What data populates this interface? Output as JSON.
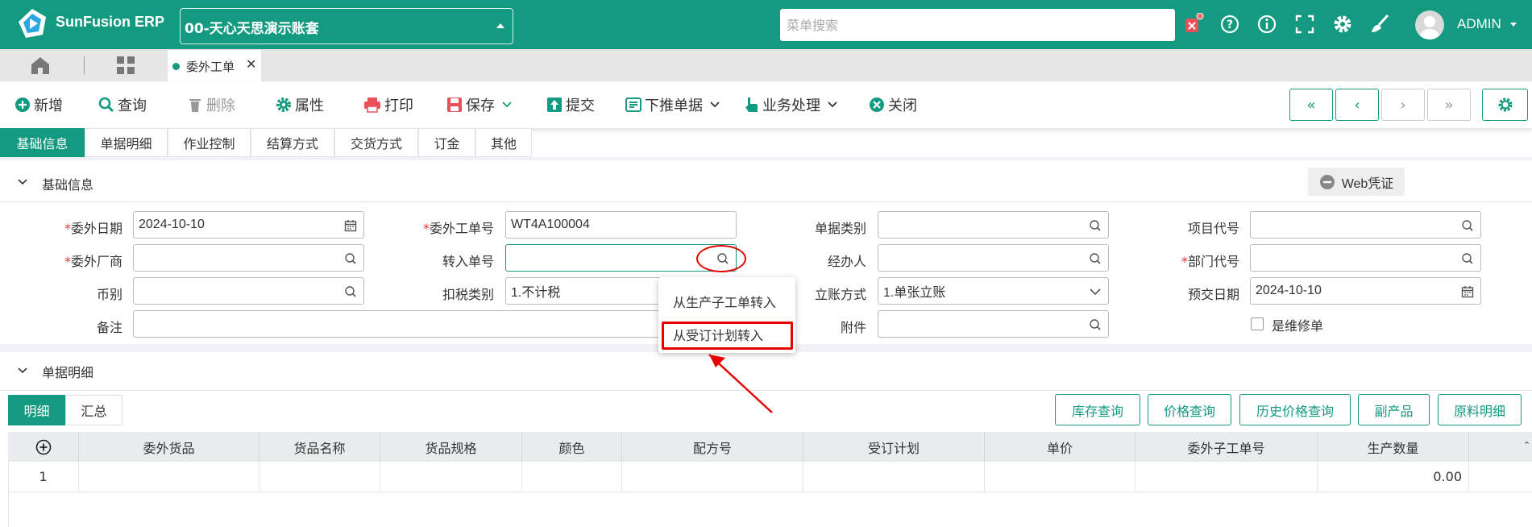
{
  "app": {
    "title": "SunFusion ERP",
    "account": "00-天心天思演示账套"
  },
  "header": {
    "search_placeholder": "菜单搜索",
    "user": "ADMIN"
  },
  "colors": {
    "brand": "#139a80",
    "danger": "#e60000"
  },
  "tabs": {
    "current": "委外工单"
  },
  "toolbar": {
    "new": "新增",
    "query": "查询",
    "delete": "删除",
    "props": "属性",
    "print": "打印",
    "save": "保存",
    "submit": "提交",
    "push": "下推单据",
    "business": "业务处理",
    "close": "关闭"
  },
  "subtabs": [
    "基础信息",
    "单据明细",
    "作业控制",
    "结算方式",
    "交货方式",
    "订金",
    "其他"
  ],
  "section_basic": {
    "title": "基础信息",
    "web_voucher": "Web凭证"
  },
  "form": {
    "outsource_date": {
      "label": "委外日期",
      "value": "2024-10-10"
    },
    "order_no": {
      "label": "委外工单号",
      "value": "WT4A100004"
    },
    "doc_type": {
      "label": "单据类别",
      "value": ""
    },
    "project_code": {
      "label": "项目代号",
      "value": ""
    },
    "vendor": {
      "label": "委外厂商",
      "value": ""
    },
    "transfer_no": {
      "label": "转入单号",
      "value": ""
    },
    "handler": {
      "label": "经办人",
      "value": ""
    },
    "dept_code": {
      "label": "部门代号",
      "value": ""
    },
    "currency": {
      "label": "币别",
      "value": ""
    },
    "tax_type": {
      "label": "扣税类别",
      "value": "1.不计税"
    },
    "account_method": {
      "label": "立账方式",
      "value": "1.单张立账"
    },
    "pre_delivery_date": {
      "label": "预交日期",
      "value": "2024-10-10"
    },
    "remark": {
      "label": "备注",
      "value": ""
    },
    "attachment": {
      "label": "附件",
      "value": ""
    },
    "is_repair": {
      "label": "是维修单",
      "checked": false
    }
  },
  "dropdown": {
    "item1": "从生产子工单转入",
    "item2": "从受订计划转入"
  },
  "section_detail": {
    "title": "单据明细"
  },
  "detail_tabs": {
    "detail": "明细",
    "summary": "汇总"
  },
  "detail_buttons": {
    "stock": "库存查询",
    "price": "价格查询",
    "history": "历史价格查询",
    "byproduct": "副产品",
    "material": "原料明细"
  },
  "grid": {
    "columns": [
      "委外货品",
      "货品名称",
      "货品规格",
      "颜色",
      "配方号",
      "受订计划",
      "单价",
      "委外子工单号",
      "生产数量"
    ],
    "rows": [
      {
        "no": "1",
        "qty": "0.00"
      }
    ]
  }
}
